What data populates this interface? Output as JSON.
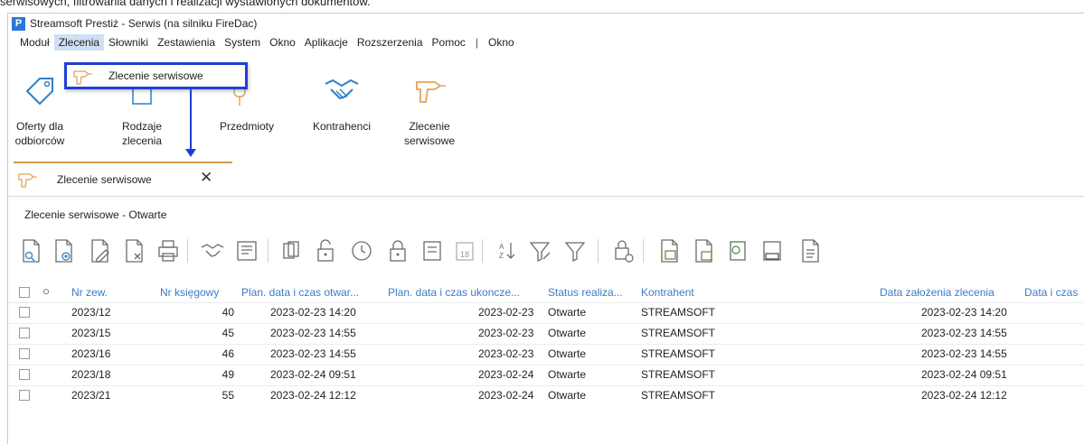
{
  "caption": "serwisowych, filtrowania danych i realizacji wystawionych dokumentów.",
  "app": {
    "title": "Streamsoft Prestiż - Serwis (na silniku FireDac)",
    "logo_letter": "P"
  },
  "menu": [
    "Moduł",
    "Zlecenia",
    "Słowniki",
    "Zestawienia",
    "System",
    "Okno",
    "Aplikacje",
    "Rozszerzenia",
    "Pomoc",
    "|",
    "Okno"
  ],
  "ribbon": [
    {
      "label": "Oferty dla\nodbiorców",
      "icon": "offer-tag-icon"
    },
    {
      "label": "Rodzaje\nzlecenia",
      "icon": "order-types-icon"
    },
    {
      "label": "Przedmioty",
      "icon": "key-icon"
    },
    {
      "label": "Kontrahenci",
      "icon": "handshake-icon"
    },
    {
      "label": "Zlecenie\nserwisowe",
      "icon": "drill-icon"
    }
  ],
  "dropdown": {
    "item_label": "Zlecenie serwisowe",
    "icon": "drill-icon"
  },
  "tab": {
    "label": "Zlecenie serwisowe",
    "close": "✕"
  },
  "section_title": "Zlecenie serwisowe - Otwarte",
  "toolbar_icons": [
    "preview-document-icon",
    "add-document-icon",
    "edit-document-icon",
    "delete-document-icon",
    "print-icon",
    "handshake-icon",
    "list-view-icon",
    "copy-icon",
    "unlock-icon",
    "clock-icon",
    "lock-icon",
    "calendar-list-icon",
    "calendar-icon",
    "sort-icon",
    "filter-edit-icon",
    "filter-icon",
    "lock-check-icon",
    "export-icon",
    "import-icon",
    "money-icon",
    "register-icon",
    "document-icon"
  ],
  "grid": {
    "columns": [
      "Nr zew.",
      "Nr księgowy",
      "Plan. data i czas otwar...",
      "Plan. data i czas ukoncze...",
      "Status realiza...",
      "Kontrahent",
      "Data założenia zlecenia",
      "Data i czas"
    ],
    "rows": [
      [
        "2023/12",
        "40",
        "2023-02-23 14:20",
        "2023-02-23",
        "Otwarte",
        "STREAMSOFT",
        "2023-02-23 14:20"
      ],
      [
        "2023/15",
        "45",
        "2023-02-23 14:55",
        "2023-02-23",
        "Otwarte",
        "STREAMSOFT",
        "2023-02-23 14:55"
      ],
      [
        "2023/16",
        "46",
        "2023-02-23 14:55",
        "2023-02-23",
        "Otwarte",
        "STREAMSOFT",
        "2023-02-23 14:55"
      ],
      [
        "2023/18",
        "49",
        "2023-02-24 09:51",
        "2023-02-24",
        "Otwarte",
        "STREAMSOFT",
        "2023-02-24 09:51"
      ],
      [
        "2023/21",
        "55",
        "2023-02-24 12:12",
        "2023-02-24",
        "Otwarte",
        "STREAMSOFT",
        "2023-02-24 12:12"
      ]
    ]
  },
  "colors": {
    "highlight_border": "#1f3fd6",
    "header_text": "#3d7bc6",
    "menu_active": "#cfe0f3",
    "icon_blue": "#2d7fc4",
    "icon_orange": "#e0a55a"
  }
}
